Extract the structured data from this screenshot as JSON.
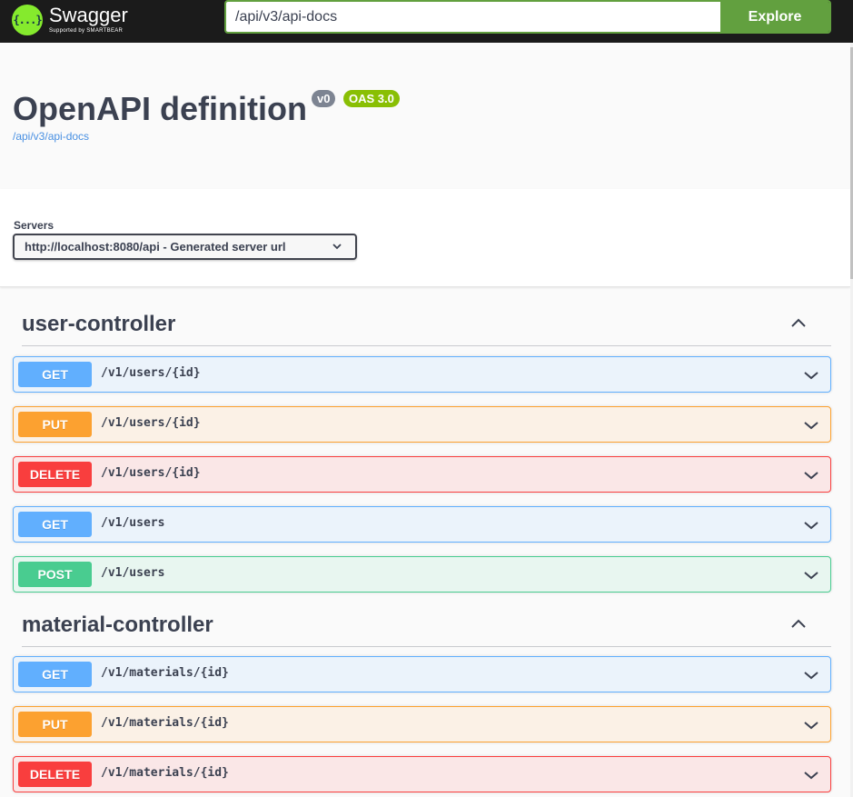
{
  "topbar": {
    "logo_symbol": "{...}",
    "logo_name": "Swagger",
    "logo_sub": "Supported by SMARTBEAR",
    "url_value": "/api/v3/api-docs",
    "explore_label": "Explore",
    "accent_color": "#62a03f"
  },
  "info": {
    "title": "OpenAPI definition",
    "version_badge": "v0",
    "oas_badge": "OAS 3.0",
    "link": "/api/v3/api-docs"
  },
  "servers": {
    "label": "Servers",
    "selected": "http://localhost:8080/api - Generated server url"
  },
  "tags": [
    {
      "name": "user-controller",
      "operations": [
        {
          "method": "GET",
          "path": "/v1/users/{id}"
        },
        {
          "method": "PUT",
          "path": "/v1/users/{id}"
        },
        {
          "method": "DELETE",
          "path": "/v1/users/{id}"
        },
        {
          "method": "GET",
          "path": "/v1/users"
        },
        {
          "method": "POST",
          "path": "/v1/users"
        }
      ]
    },
    {
      "name": "material-controller",
      "operations": [
        {
          "method": "GET",
          "path": "/v1/materials/{id}"
        },
        {
          "method": "PUT",
          "path": "/v1/materials/{id}"
        },
        {
          "method": "DELETE",
          "path": "/v1/materials/{id}"
        }
      ]
    }
  ],
  "colors": {
    "get": "#61affe",
    "put": "#fca130",
    "delete": "#f93e3e",
    "post": "#49cc90"
  }
}
